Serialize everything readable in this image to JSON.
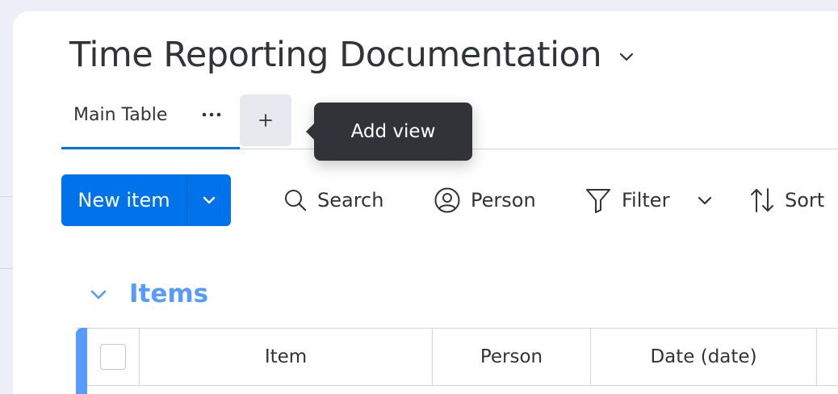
{
  "board": {
    "title": "Time Reporting Documentation"
  },
  "views": {
    "tabs": [
      {
        "label": "Main Table",
        "active": true
      }
    ],
    "add_button_glyph": "+",
    "tooltip": "Add view"
  },
  "toolbar": {
    "new_item_label": "New item",
    "search_label": "Search",
    "person_label": "Person",
    "filter_label": "Filter",
    "sort_label": "Sort"
  },
  "group": {
    "title": "Items",
    "color": "#579bfc"
  },
  "table": {
    "columns": [
      "Item",
      "Person",
      "Date (date)"
    ]
  },
  "colors": {
    "accent": "#0073ea",
    "text": "#323338",
    "tooltip_bg": "#323338",
    "border": "#d0d4e4",
    "background": "#eceff8"
  },
  "icons": [
    "chevron-down-icon",
    "more-horizontal-icon",
    "plus-icon",
    "search-icon",
    "person-icon",
    "filter-icon",
    "sort-icon"
  ]
}
